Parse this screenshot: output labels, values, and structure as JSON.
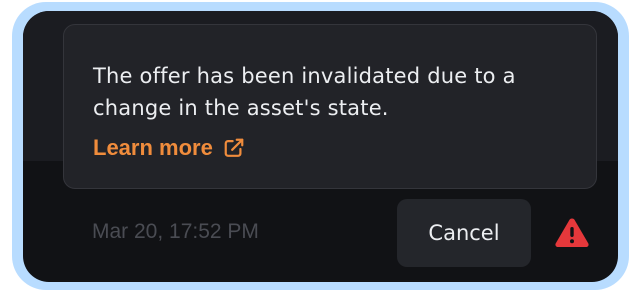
{
  "tooltip": {
    "message": "The offer has been invalidated due to a change in the asset's state.",
    "link_label": "Learn more",
    "link_icon": "external-link-icon"
  },
  "row": {
    "timestamp": "Mar 20, 17:52 PM",
    "cancel_label": "Cancel",
    "status_icon": "warning-icon"
  },
  "colors": {
    "accent": "#f08c3c",
    "warning": "#e5383b",
    "background": "#111215",
    "tooltip_background": "#222328",
    "frame": "#b8dcff"
  }
}
